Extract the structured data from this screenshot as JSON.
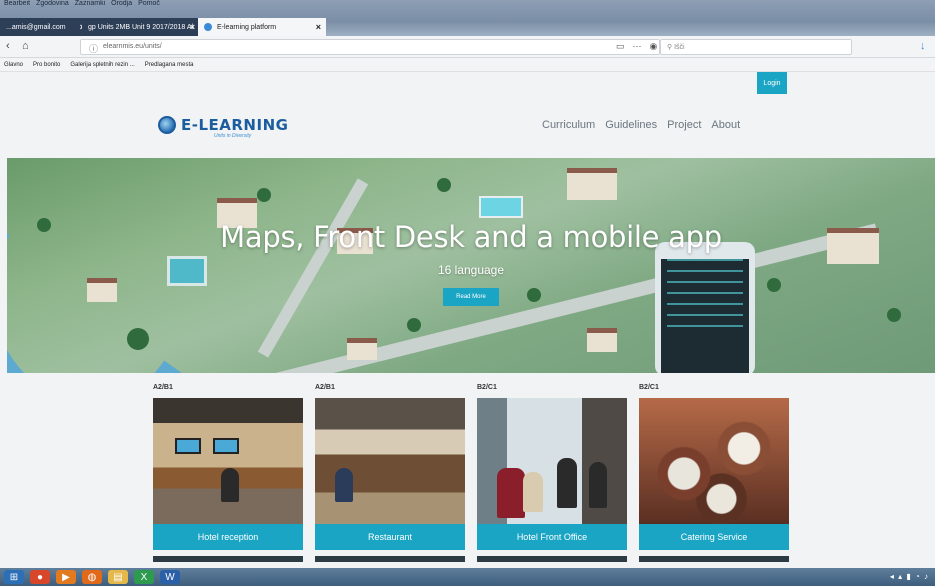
{
  "browser": {
    "menu": [
      "Bearbeit",
      "Zgodovina",
      "Zaznamki",
      "Orodja",
      "Pomoč"
    ],
    "tabs": [
      {
        "label": "...amis@gmail.com"
      },
      {
        "label": "gp Units 2MB Unit 9 2017/2018 Al"
      },
      {
        "label": "E-learning platform",
        "active": true
      }
    ],
    "url": "elearnmis.eu/units/",
    "search_placeholder": "Išči",
    "bookmarks": [
      "Glavno",
      "Pro bonito",
      "Galerija spletnih rezin ...",
      "Predlagana mesta"
    ]
  },
  "site": {
    "login_label": "Login",
    "logo": {
      "name": "E-LEARNING",
      "tagline": "Units in Diversity"
    },
    "nav": [
      "Curriculum",
      "Guidelines",
      "Project",
      "About"
    ],
    "hero": {
      "title": "Maps, Front Desk and a mobile app",
      "subtitle": "16 language",
      "button_label": "Read More"
    },
    "cards": [
      {
        "level": "A2/B1",
        "label": "Hotel reception"
      },
      {
        "level": "A2/B1",
        "label": "Restaurant"
      },
      {
        "level": "B2/C1",
        "label": "Hotel Front Office"
      },
      {
        "level": "B2/C1",
        "label": "Catering Service"
      }
    ]
  },
  "colors": {
    "accent": "#1ba5c4",
    "brand": "#1b5d9e"
  }
}
